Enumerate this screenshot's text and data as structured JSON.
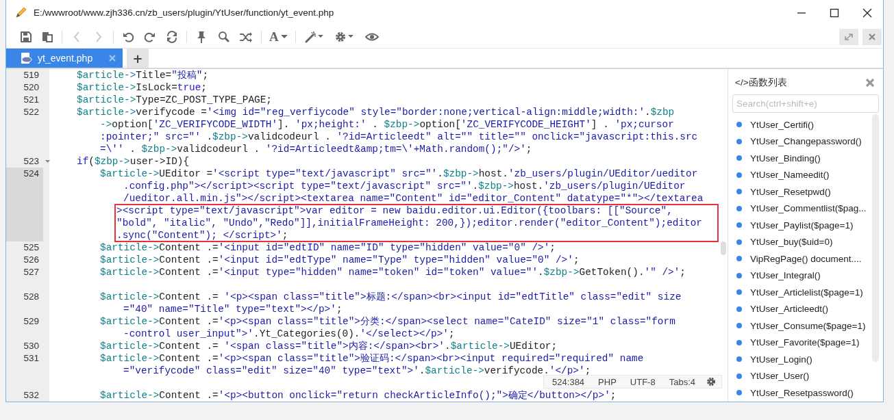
{
  "window": {
    "title": "E:/wwwroot/www.zjh336.cn/zb_users/plugin/YtUser/function/yt_event.php"
  },
  "toolbar": {
    "nav": [
      {
        "kind": "back",
        "disabled": true
      },
      {
        "kind": "forward",
        "disabled": true
      }
    ],
    "font_button_label": "A"
  },
  "tabs": [
    {
      "label": "yt_event.php",
      "selected": true
    }
  ],
  "new_tab_label": "+",
  "editor": {
    "lines": [
      {
        "number": "519",
        "active": false,
        "rows": [
          {
            "boxed": false,
            "segments": [
              {
                "kind": "var",
                "text": "$article->"
              },
              {
                "kind": "plain",
                "text": "Title="
              },
              {
                "kind": "str",
                "text": "\"投稿\""
              },
              {
                "kind": "plain",
                "text": ";"
              }
            ]
          }
        ]
      },
      {
        "number": "520",
        "active": false,
        "rows": [
          {
            "boxed": false,
            "segments": [
              {
                "kind": "var",
                "text": "$article->"
              },
              {
                "kind": "plain",
                "text": "IsLock="
              },
              {
                "kind": "kw",
                "text": "true"
              },
              {
                "kind": "plain",
                "text": ";"
              }
            ]
          }
        ]
      },
      {
        "number": "521",
        "active": false,
        "rows": [
          {
            "boxed": false,
            "segments": [
              {
                "kind": "var",
                "text": "$article->"
              },
              {
                "kind": "plain",
                "text": "Type=ZC_POST_TYPE_PAGE;"
              }
            ]
          }
        ]
      },
      {
        "number": "522",
        "active": false,
        "rows": [
          {
            "boxed": false,
            "segments": [
              {
                "kind": "var",
                "text": "$article->"
              },
              {
                "kind": "plain",
                "text": "verifycode ="
              },
              {
                "kind": "str",
                "text": "'<img id=\"reg_verfiycode\" style=\"border:none;vertical-align:middle;width:'"
              },
              {
                "kind": "plain",
                "text": "."
              },
              {
                "kind": "var",
                "text": "$zbp"
              }
            ]
          },
          {
            "boxed": false,
            "segments": [
              {
                "kind": "var",
                "text": "->"
              },
              {
                "kind": "plain",
                "text": "option["
              },
              {
                "kind": "str",
                "text": "'ZC_VERIFYCODE_WIDTH'"
              },
              {
                "kind": "plain",
                "text": "]. "
              },
              {
                "kind": "str",
                "text": "'px;height:'"
              },
              {
                "kind": "plain",
                "text": " . "
              },
              {
                "kind": "var",
                "text": "$zbp->"
              },
              {
                "kind": "plain",
                "text": "option["
              },
              {
                "kind": "str",
                "text": "'ZC_VERIFYCODE_HEIGHT'"
              },
              {
                "kind": "plain",
                "text": "] . "
              },
              {
                "kind": "str",
                "text": "'px;cursor"
              }
            ]
          },
          {
            "boxed": false,
            "segments": [
              {
                "kind": "str",
                "text": ":pointer;\" src=\"'"
              },
              {
                "kind": "plain",
                "text": " ."
              },
              {
                "kind": "var",
                "text": "$zbp->"
              },
              {
                "kind": "plain",
                "text": "validcodeurl . "
              },
              {
                "kind": "str",
                "text": "'?id=Articleedt\" alt=\"\" title=\"\" onclick=\"javascript:this.src"
              }
            ]
          },
          {
            "boxed": false,
            "segments": [
              {
                "kind": "str",
                "text": "=\\''"
              },
              {
                "kind": "plain",
                "text": " . "
              },
              {
                "kind": "var",
                "text": "$zbp->"
              },
              {
                "kind": "plain",
                "text": "validcodeurl . "
              },
              {
                "kind": "str",
                "text": "'?id=Articleedt&amp;tm=\\'+Math.random();\"/>'"
              },
              {
                "kind": "plain",
                "text": ";"
              }
            ]
          }
        ]
      },
      {
        "number": "523",
        "active": false,
        "rows": [
          {
            "boxed": false,
            "segments": [
              {
                "kind": "kw",
                "text": "if"
              },
              {
                "kind": "plain",
                "text": "("
              },
              {
                "kind": "var",
                "text": "$zbp->"
              },
              {
                "kind": "plain",
                "text": "user->ID){"
              }
            ]
          }
        ],
        "children": [
          {
            "number": "524",
            "active": true,
            "rows": [
              {
                "boxed": false,
                "segments": [
                  {
                    "kind": "var",
                    "text": "$article->"
                  },
                  {
                    "kind": "plain",
                    "text": "UEditor ="
                  },
                  {
                    "kind": "str",
                    "text": "'<script type=\"text/javascript\" src=\"'"
                  },
                  {
                    "kind": "plain",
                    "text": "."
                  },
                  {
                    "kind": "var",
                    "text": "$zbp->"
                  },
                  {
                    "kind": "plain",
                    "text": "host."
                  },
                  {
                    "kind": "str",
                    "text": "'zb_users/plugin/UEditor/ueditor"
                  }
                ]
              },
              {
                "boxed": false,
                "segments": [
                  {
                    "kind": "str",
                    "text": ".config.php\"></script><script type=\"text/javascript\" src=\"'"
                  },
                  {
                    "kind": "plain",
                    "text": "."
                  },
                  {
                    "kind": "var",
                    "text": "$zbp->"
                  },
                  {
                    "kind": "plain",
                    "text": "host."
                  },
                  {
                    "kind": "str",
                    "text": "'zb_users/plugin/UEditor"
                  }
                ]
              },
              {
                "boxed": false,
                "segments": [
                  {
                    "kind": "str",
                    "text": "/ueditor.all.min.js\"></script><textarea name=\"Content\" id=\"editor_Content\" datatype=\"*\"></textarea"
                  }
                ]
              },
              {
                "boxed": true,
                "segments": [
                  {
                    "kind": "str",
                    "text": "><script type=\"text/javascript\">var editor = new baidu.editor.ui.Editor({toolbars: [[\"Source\","
                  }
                ]
              },
              {
                "boxed": true,
                "segments": [
                  {
                    "kind": "str",
                    "text": "\"bold\", \"italic\", \"Undo\",\"Redo\"]],initialFrameHeight: 200,});editor.render(\"editor_Content\");editor"
                  }
                ]
              },
              {
                "boxed": true,
                "segments": [
                  {
                    "kind": "str",
                    "text": ".sync(\"Content\"); </script>'"
                  },
                  {
                    "kind": "plain",
                    "text": ";"
                  }
                ]
              }
            ]
          },
          {
            "number": "525",
            "active": false,
            "rows": [
              {
                "boxed": false,
                "segments": [
                  {
                    "kind": "var",
                    "text": "$article->"
                  },
                  {
                    "kind": "plain",
                    "text": "Content .="
                  },
                  {
                    "kind": "str",
                    "text": "'<input id=\"edtID\" name=\"ID\" type=\"hidden\" value=\"0\" />'"
                  },
                  {
                    "kind": "plain",
                    "text": ";"
                  }
                ]
              }
            ]
          },
          {
            "number": "526",
            "active": false,
            "rows": [
              {
                "boxed": false,
                "segments": [
                  {
                    "kind": "var",
                    "text": "$article->"
                  },
                  {
                    "kind": "plain",
                    "text": "Content .="
                  },
                  {
                    "kind": "str",
                    "text": "'<input id=\"edtType\" name=\"Type\" type=\"hidden\" value=\"0\" />'"
                  },
                  {
                    "kind": "plain",
                    "text": ";"
                  }
                ]
              }
            ]
          },
          {
            "number": "527",
            "active": false,
            "rows": [
              {
                "boxed": false,
                "segments": [
                  {
                    "kind": "var",
                    "text": "$article->"
                  },
                  {
                    "kind": "plain",
                    "text": "Content .="
                  },
                  {
                    "kind": "str",
                    "text": "'<input type=\"hidden\" name=\"token\" id=\"token\" value=\"'"
                  },
                  {
                    "kind": "plain",
                    "text": "."
                  },
                  {
                    "kind": "var",
                    "text": "$zbp->"
                  },
                  {
                    "kind": "plain",
                    "text": "GetToken()."
                  },
                  {
                    "kind": "str",
                    "text": "'\" />'"
                  },
                  {
                    "kind": "plain",
                    "text": ";"
                  }
                ]
              },
              {
                "segments": []
              }
            ]
          },
          {
            "number": "528",
            "active": false,
            "rows": [
              {
                "boxed": false,
                "segments": [
                  {
                    "kind": "var",
                    "text": "$article->"
                  },
                  {
                    "kind": "plain",
                    "text": "Content .= "
                  },
                  {
                    "kind": "str",
                    "text": "'<p><span class=\"title\">标题:</span><br><input id=\"edtTitle\" class=\"edit\" size"
                  }
                ]
              },
              {
                "boxed": false,
                "segments": [
                  {
                    "kind": "str",
                    "text": "=\"40\" name=\"Title\" type=\"text\"></p>'"
                  },
                  {
                    "kind": "plain",
                    "text": ";"
                  }
                ]
              }
            ]
          },
          {
            "number": "529",
            "active": false,
            "rows": [
              {
                "boxed": false,
                "segments": [
                  {
                    "kind": "var",
                    "text": "$article->"
                  },
                  {
                    "kind": "plain",
                    "text": "Content .="
                  },
                  {
                    "kind": "str",
                    "text": "'<p><span class=\"title\">分类:</span><select name=\"CateID\" size=\"1\" class=\"form"
                  }
                ]
              },
              {
                "boxed": false,
                "segments": [
                  {
                    "kind": "str",
                    "text": "-control user_input\">'"
                  },
                  {
                    "kind": "plain",
                    "text": ".Yt_Categories(0)."
                  },
                  {
                    "kind": "str",
                    "text": "'</select></p>'"
                  },
                  {
                    "kind": "plain",
                    "text": ";"
                  }
                ]
              }
            ]
          },
          {
            "number": "530",
            "active": false,
            "rows": [
              {
                "boxed": false,
                "segments": [
                  {
                    "kind": "var",
                    "text": "$article->"
                  },
                  {
                    "kind": "plain",
                    "text": "Content .= "
                  },
                  {
                    "kind": "str",
                    "text": "'<span class=\"title\">内容:</span><br>'"
                  },
                  {
                    "kind": "plain",
                    "text": "."
                  },
                  {
                    "kind": "var",
                    "text": "$article->"
                  },
                  {
                    "kind": "plain",
                    "text": "UEditor;"
                  }
                ]
              }
            ]
          },
          {
            "number": "531",
            "active": false,
            "rows": [
              {
                "boxed": false,
                "segments": [
                  {
                    "kind": "var",
                    "text": "$article->"
                  },
                  {
                    "kind": "plain",
                    "text": "Content .="
                  },
                  {
                    "kind": "str",
                    "text": "'<p><span class=\"title\">验证码:</span><br><input required=\"required\" name"
                  }
                ]
              },
              {
                "boxed": false,
                "segments": [
                  {
                    "kind": "str",
                    "text": "=\"verifycode\" class=\"edit\" size=\"40\" type=\"text\">'"
                  },
                  {
                    "kind": "plain",
                    "text": "."
                  },
                  {
                    "kind": "var",
                    "text": "$article->"
                  },
                  {
                    "kind": "plain",
                    "text": "verifycode."
                  },
                  {
                    "kind": "str",
                    "text": "'</p>'"
                  },
                  {
                    "kind": "plain",
                    "text": ";"
                  }
                ]
              },
              {
                "segments": []
              }
            ]
          },
          {
            "number": "532",
            "active": false,
            "rows": [
              {
                "boxed": false,
                "segments": [
                  {
                    "kind": "var",
                    "text": "$article->"
                  },
                  {
                    "kind": "plain",
                    "text": "Content .="
                  },
                  {
                    "kind": "str",
                    "text": "'<p><button onclick=\"return checkArticleInfo();\">确定</button></p>'"
                  },
                  {
                    "kind": "plain",
                    "text": ";"
                  }
                ]
              }
            ]
          }
        ]
      }
    ]
  },
  "status_bar": {
    "position": "524:384",
    "language": "PHP",
    "encoding": "UTF-8",
    "indent": "Tabs:4"
  },
  "outline_panel": {
    "title": "</>函数列表",
    "search": {
      "placeholder": "Search(ctrl+shift+e)"
    },
    "items": [
      "YtUser_Certifi()",
      "YtUser_Changepassword()",
      "YtUser_Binding()",
      "YtUser_Nameedit()",
      "YtUser_Resetpwd()",
      "YtUser_Commentlist($pag...",
      "YtUser_Paylist($page=1)",
      "YtUser_buy($uid=0)",
      "VipRegPage() document....",
      "YtUser_Integral()",
      "YtUser_Articlelist($page=1)",
      "YtUser_Articleedt()",
      "YtUser_Consume($page=1)",
      "YtUser_Favorite($page=1)",
      "YtUser_Login()",
      "YtUser_User()",
      "YtUser_Resetpassword()"
    ]
  }
}
